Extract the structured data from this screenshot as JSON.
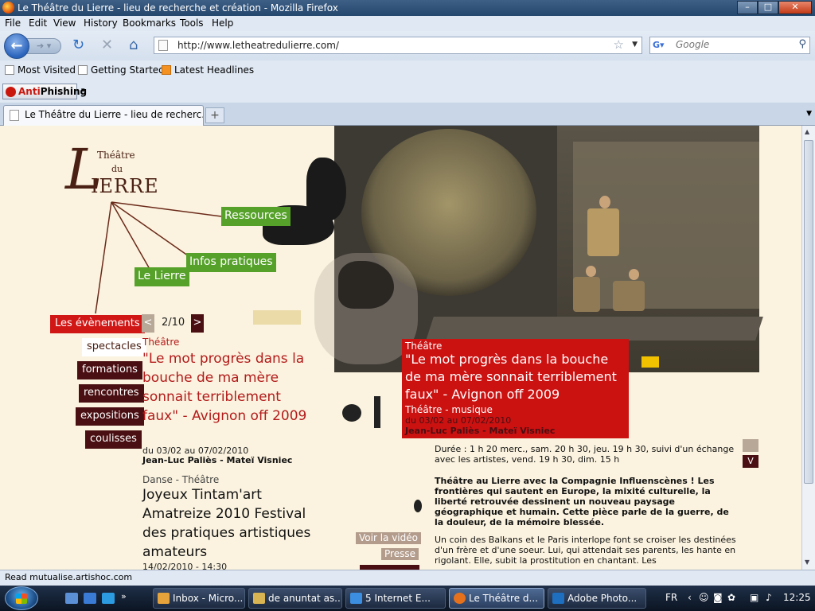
{
  "window": {
    "title": "Le Théâtre du Lierre - lieu de recherche et création - Mozilla Firefox"
  },
  "menu": [
    "File",
    "Edit",
    "View",
    "History",
    "Bookmarks",
    "Tools",
    "Help"
  ],
  "address": {
    "url": "http://www.letheatredulierre.com/"
  },
  "search": {
    "placeholder": "Google"
  },
  "bookmarks": [
    "Most Visited",
    "Getting Started",
    "Latest Headlines"
  ],
  "addon": {
    "anti": "Anti",
    "phishing": "Phishing"
  },
  "tab": {
    "label": "Le Théâtre du Lierre - lieu de recherc..."
  },
  "logo": {
    "theatre": "Théâtre",
    "du": "du",
    "big_l": "L",
    "ierre": "IERRE"
  },
  "nav_green": [
    "Ressources",
    "Infos pratiques",
    "Le Lierre"
  ],
  "left_menu": {
    "active": "Les évènements",
    "items": [
      "spectacles",
      "formations",
      "rencontres",
      "expositions",
      "coulisses"
    ]
  },
  "pager": {
    "prev": "<",
    "count": "2/10",
    "next": ">"
  },
  "events": [
    {
      "category": "Théâtre",
      "title": "\"Le mot progrès dans la bouche de ma mère sonnait terriblement faux\" - Avignon off 2009",
      "dates": "du 03/02 au 07/02/2010",
      "authors": "Jean-Luc Paliès - Mateï Visniec"
    },
    {
      "category": "Danse - Théâtre",
      "title": "Joyeux Tintam'art Amatreize 2010 Festival des pratiques artistiques amateurs",
      "dates": "14/02/2010 - 14:30"
    }
  ],
  "feature": {
    "category": "Théâtre",
    "title": "\"Le mot progrès dans la bouche de ma mère sonnait terriblement faux\" - Avignon off 2009",
    "subtitle": "Théâtre - musique",
    "dates": "du 03/02 au 07/02/2010",
    "authors": "Jean-Luc Paliès - Mateï Visniec"
  },
  "detail": {
    "duration": "Durée : 1 h 20 merc., sam. 20 h 30, jeu. 19 h 30, suivi d'un échange avec les artistes, vend. 19 h 30, dim. 15 h",
    "intro_bold": "Théâtre au Lierre avec la  Compagnie Influenscènes ! Les frontières qui sautent en Europe, la mixité culturelle, la liberté retrouvée dessinent un nouveau paysage géographique et humain. Cette pièce parle de la guerre, de la douleur, de la mémoire blessée.",
    "body": "Un coin des Balkans et le Paris interlope font se croiser les destinées d'un frère et d'une soeur. Lui, qui attendait ses parents, les hante en rigolant. Elle, subit la prostitution en chantant. Les"
  },
  "actions": {
    "video": "Voir la vidéo",
    "press": "Presse"
  },
  "side_buttons": {
    "up": "",
    "down": "V"
  },
  "status": {
    "text": "Read mutualise.artishoc.com"
  },
  "taskbar": {
    "tasks": [
      "Inbox - Micro...",
      "de anuntat as...",
      "5 Internet E...",
      "Le Théâtre d...",
      "Adobe Photo..."
    ],
    "lang": "FR",
    "clock": "12:25"
  },
  "colors": {
    "accent_red": "#cc1111",
    "green": "#56a12a",
    "dark": "#4a0f12",
    "page_bg": "#fbf3df"
  }
}
